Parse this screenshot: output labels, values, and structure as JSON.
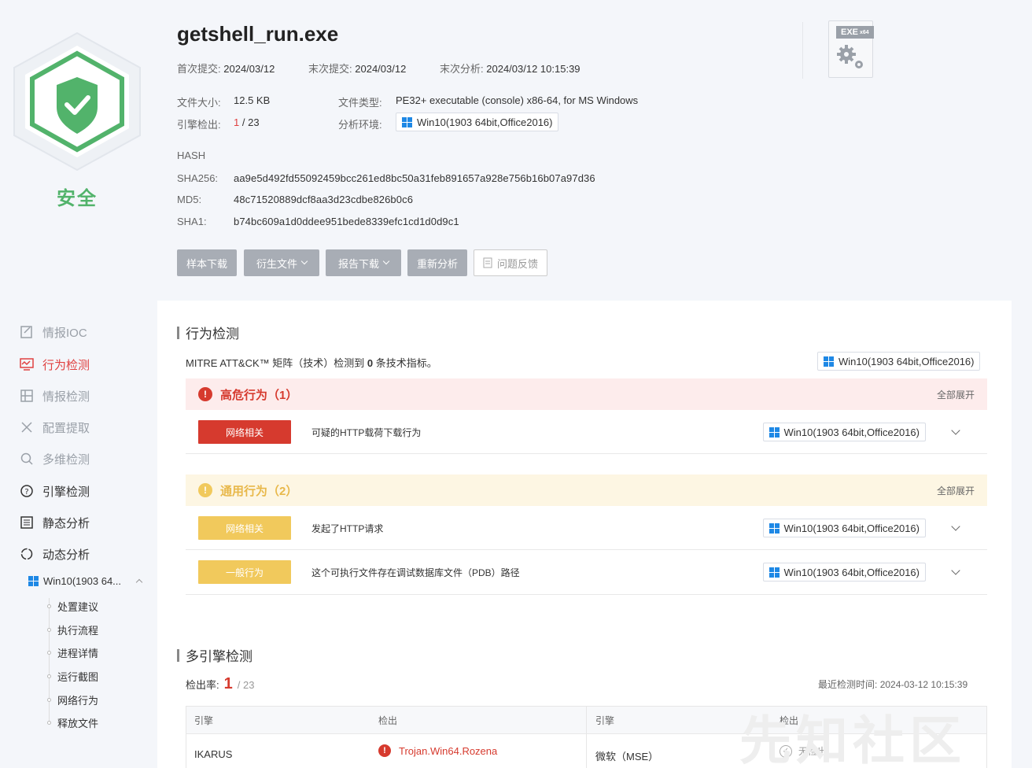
{
  "verdict": {
    "label": "安全",
    "color": "#52b36b"
  },
  "file": {
    "name": "getshell_run.exe",
    "first_submit_label": "首次提交:",
    "first_submit": "2024/03/12",
    "last_submit_label": "末次提交:",
    "last_submit": "2024/03/12",
    "last_analysis_label": "末次分析:",
    "last_analysis": "2024/03/12 10:15:39",
    "size_label": "文件大小:",
    "size": "12.5 KB",
    "type_label": "文件类型:",
    "type": "PE32+ executable (console) x86-64, for MS Windows",
    "engine_label": "引擎检出:",
    "engine_hits": "1",
    "engine_total": "/ 23",
    "env_label": "分析环境:",
    "env": "Win10(1903 64bit,Office2016)",
    "exe_icon_text": "EXE",
    "exe_icon_sub": "x64"
  },
  "hash": {
    "title": "HASH",
    "sha256_label": "SHA256:",
    "sha256": "aa9e5d492fd55092459bcc261ed8bc50a31feb891657a928e756b16b07a97d36",
    "md5_label": "MD5:",
    "md5": "48c71520889dcf8aa3d23cdbe826b0c6",
    "sha1_label": "SHA1:",
    "sha1": "b74bc609a1d0ddee951bede8339efc1cd1d0d9c1"
  },
  "actions": {
    "sample_download": "样本下载",
    "derived_files": "衍生文件",
    "report_download": "报告下载",
    "reanalyze": "重新分析",
    "feedback": "问题反馈"
  },
  "sidebar": {
    "items": [
      {
        "label": "情报IOC"
      },
      {
        "label": "行为检测"
      },
      {
        "label": "情报检测"
      },
      {
        "label": "配置提取"
      },
      {
        "label": "多维检测"
      },
      {
        "label": "引擎检测"
      },
      {
        "label": "静态分析"
      },
      {
        "label": "动态分析"
      }
    ],
    "env_node": "Win10(1903 64...",
    "sub_items": [
      "处置建议",
      "执行流程",
      "进程详情",
      "运行截图",
      "网络行为",
      "释放文件"
    ]
  },
  "behavior": {
    "title": "行为检测",
    "summary_prefix": "MITRE ATT&CK™ 矩阵（技术）检测到 ",
    "summary_count": "0",
    "summary_suffix": " 条技术指标。",
    "env": "Win10(1903 64bit,Office2016)",
    "high": {
      "title": "高危行为（1）",
      "expand": "全部展开",
      "rows": [
        {
          "tag": "网络相关",
          "desc": "可疑的HTTP载荷下载行为",
          "env": "Win10(1903 64bit,Office2016)"
        }
      ]
    },
    "general": {
      "title": "通用行为（2）",
      "expand": "全部展开",
      "rows": [
        {
          "tag": "网络相关",
          "desc": "发起了HTTP请求",
          "env": "Win10(1903 64bit,Office2016)"
        },
        {
          "tag": "一般行为",
          "desc": "这个可执行文件存在调试数据库文件（PDB）路径",
          "env": "Win10(1903 64bit,Office2016)"
        }
      ]
    }
  },
  "multi_engine": {
    "title": "多引擎检测",
    "rate_label": "检出率:",
    "rate_hits": "1",
    "rate_total": "/ 23",
    "last_time_label": "最近检测时间:",
    "last_time": "2024-03-12 10:15:39",
    "headers": [
      "引擎",
      "检出",
      "引擎",
      "检出"
    ],
    "rows": [
      {
        "engine1": "IKARUS",
        "result1": "Trojan.Win64.Rozena",
        "engine2": "微软（MSE）",
        "result2": "无检出"
      }
    ]
  },
  "watermark": "先知社区",
  "colors": {
    "danger": "#d63a2e",
    "warning": "#f1c95c",
    "safe": "#52b36b",
    "accent_red": "#e04141"
  }
}
